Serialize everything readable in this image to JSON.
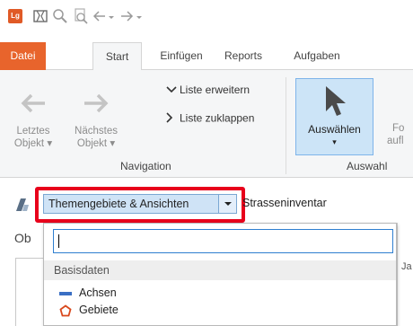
{
  "quick_access": {
    "app_logo": "Lg",
    "icons": [
      "map-icon",
      "zoom-icon",
      "zoom-page-icon",
      "back-arrow-icon",
      "dropdown-icon",
      "forward-arrow-icon",
      "dropdown-icon"
    ]
  },
  "tabs": [
    {
      "label": "Datei"
    },
    {
      "label": "Start"
    },
    {
      "label": "Einfügen"
    },
    {
      "label": "Reports"
    },
    {
      "label": "Aufgaben"
    }
  ],
  "ribbon": {
    "prev_object": {
      "line1": "Letztes",
      "line2": "Objekt ▾"
    },
    "next_object": {
      "line1": "Nächstes",
      "line2": "Objekt ▾"
    },
    "expand_list": "Liste erweitern",
    "collapse_list": "Liste zuklappen",
    "navigation_group": "Navigation",
    "select_button": {
      "label": "Auswählen",
      "arrow": "▾"
    },
    "partial_button": {
      "line1": "Fo",
      "line2": "aufl"
    },
    "selection_group": "Auswahl"
  },
  "filterbar": {
    "combo_value": "Themengebiete & Ansichten",
    "route_value": "Strasseninventar",
    "highlight_color": "#e8001b"
  },
  "left_panel": {
    "label": "Ob"
  },
  "dropdown": {
    "search_value": "",
    "section_title": "Basisdaten",
    "items": [
      {
        "label": "Achsen",
        "icon": "axis-line-icon",
        "color": "#3a6fc4"
      },
      {
        "label": "Gebiete",
        "icon": "area-polygon-icon",
        "color": "#d9481c"
      }
    ],
    "partial_right_text": "Ja"
  },
  "colors": {
    "accent_file_tab": "#e8642c",
    "selection_blue": "#cce4f7",
    "focus_blue": "#2f7fd0"
  }
}
